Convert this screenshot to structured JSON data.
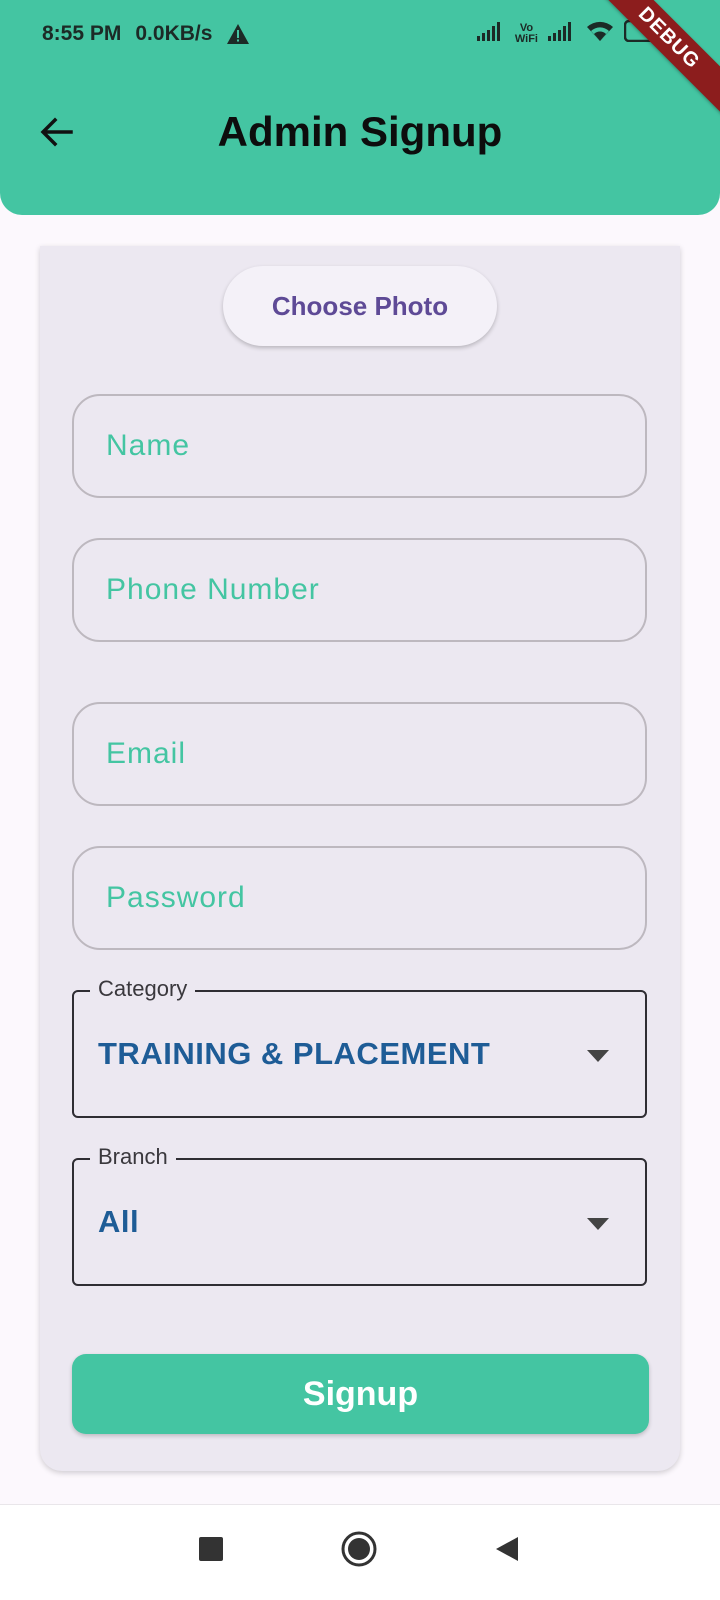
{
  "status_bar": {
    "time": "8:55 PM",
    "speed": "0.0KB/s",
    "vowifi_top": "Vo",
    "vowifi_bottom": "WiFi"
  },
  "debug_banner": "DEBUG",
  "header": {
    "title": "Admin Signup"
  },
  "form": {
    "choose_photo_label": "Choose Photo",
    "name_placeholder": "Name",
    "phone_placeholder": "Phone Number",
    "email_placeholder": "Email",
    "password_placeholder": "Password",
    "category": {
      "label": "Category",
      "value": "TRAINING & PLACEMENT"
    },
    "branch": {
      "label": "Branch",
      "value": "All"
    },
    "signup_label": "Signup"
  },
  "colors": {
    "accent": "#44c5a2",
    "dropdown_value": "#1e5c96",
    "button_text": "#5e4a96",
    "debug_ribbon": "#8c1d1d"
  }
}
